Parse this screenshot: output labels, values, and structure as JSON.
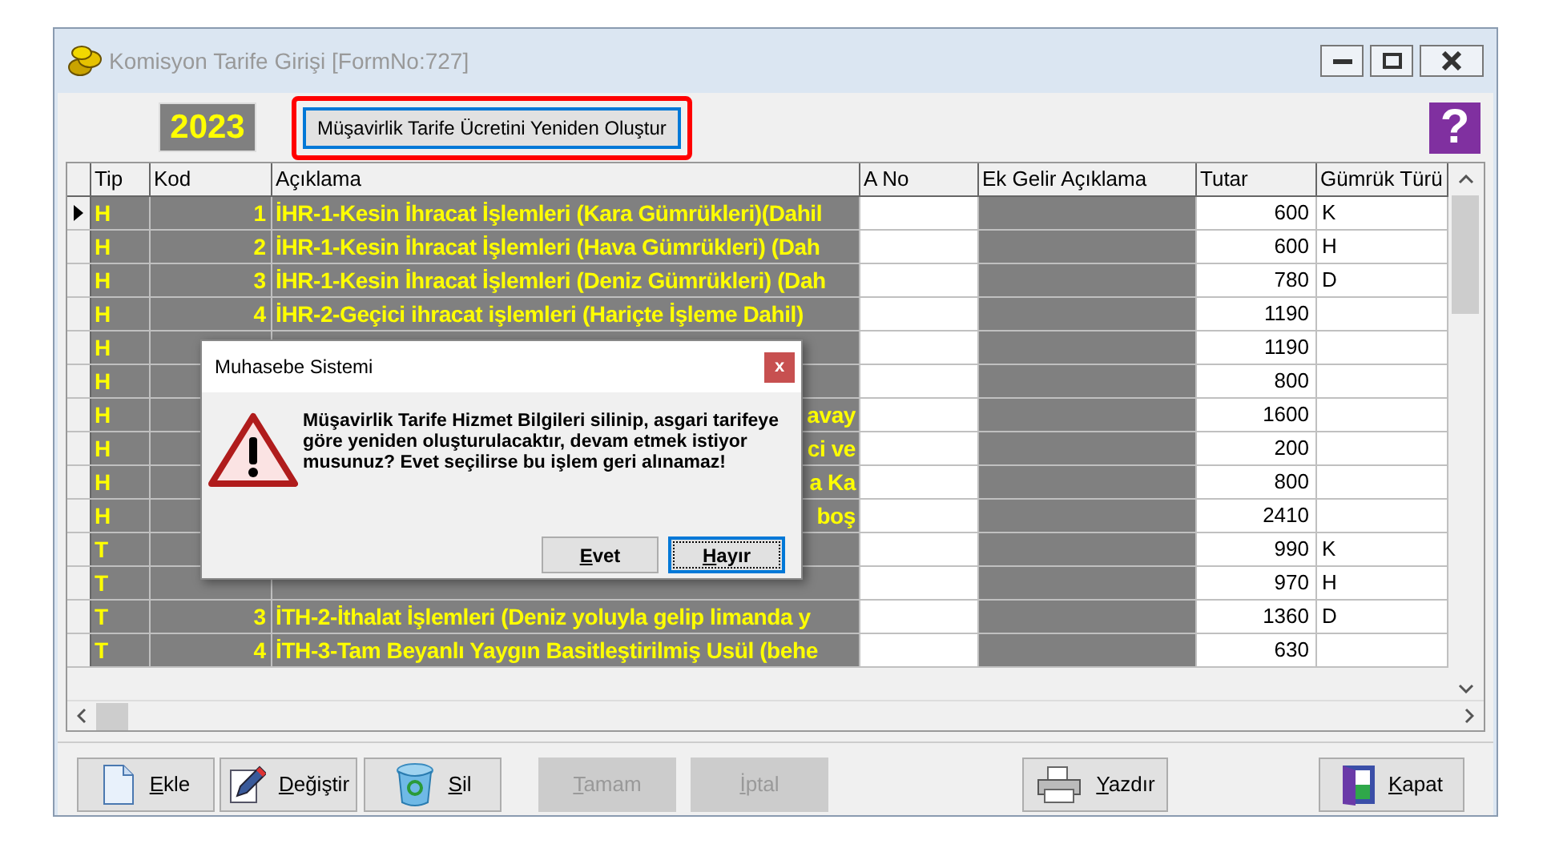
{
  "window": {
    "title": "Komisyon Tarife Girişi [FormNo:727]"
  },
  "toolbar": {
    "year": "2023",
    "rebuild_button": "Müşavirlik Tarife Ücretini Yeniden Oluştur",
    "help_button": "?"
  },
  "table": {
    "columns": [
      "Tip",
      "Kod",
      "Açıklama",
      "A No",
      "Ek Gelir Açıklama",
      "Tutar",
      "Gümrük Türü"
    ],
    "rows": [
      {
        "kind": "full",
        "selected": true,
        "tip": "H",
        "kod": "1",
        "aciklama": "İHR-1-Kesin İhracat İşlemleri (Kara Gümrükleri)(Dahil",
        "tutar": "600",
        "gumruk": "K"
      },
      {
        "kind": "full",
        "selected": false,
        "tip": "H",
        "kod": "2",
        "aciklama": "İHR-1-Kesin İhracat İşlemleri (Hava Gümrükleri) (Dah",
        "tutar": "600",
        "gumruk": "H"
      },
      {
        "kind": "full",
        "selected": false,
        "tip": "H",
        "kod": "3",
        "aciklama": "İHR-1-Kesin İhracat İşlemleri (Deniz Gümrükleri) (Dah",
        "tutar": "780",
        "gumruk": "D"
      },
      {
        "kind": "full",
        "selected": false,
        "tip": "H",
        "kod": "4",
        "aciklama": "İHR-2-Geçici ihracat işlemleri (Hariçte İşleme Dahil)",
        "tutar": "1190"
      },
      {
        "kind": "covered",
        "selected": false,
        "tip": "H",
        "tutar": "1190"
      },
      {
        "kind": "covered",
        "selected": false,
        "tip": "H",
        "tutar": "800"
      },
      {
        "kind": "covered",
        "selected": false,
        "tip": "H",
        "aciklama": "avay",
        "tutar": "1600"
      },
      {
        "kind": "covered",
        "selected": false,
        "tip": "H",
        "aciklama": "ci ve",
        "tutar": "200"
      },
      {
        "kind": "covered",
        "selected": false,
        "tip": "H",
        "aciklama": "a Ka",
        "tutar": "800"
      },
      {
        "kind": "covered",
        "selected": false,
        "tip": "H",
        "aciklama": "boş",
        "tutar": "2410"
      },
      {
        "kind": "covered",
        "selected": false,
        "tip": "T",
        "tutar": "990",
        "gumruk": "K"
      },
      {
        "kind": "covered",
        "selected": false,
        "tip": "T",
        "tutar": "970",
        "gumruk": "H"
      },
      {
        "kind": "full",
        "selected": false,
        "tip": "T",
        "kod": "3",
        "aciklama": "İTH-2-İthalat İşlemleri (Deniz yoluyla gelip limanda y",
        "tutar": "1360",
        "gumruk": "D"
      },
      {
        "kind": "full",
        "selected": false,
        "tip": "T",
        "kod": "4",
        "aciklama": "İTH-3-Tam Beyanlı Yaygın Basitleştirilmiş Usül (behe",
        "tutar": "630"
      }
    ]
  },
  "buttons": [
    {
      "kind": "add",
      "label": "Ekle",
      "disabled": false
    },
    {
      "kind": "edit",
      "label": "Değiştir",
      "disabled": false
    },
    {
      "kind": "delete",
      "label": "Sil",
      "disabled": false
    },
    {
      "kind": "ok",
      "label": "Tamam",
      "disabled": true
    },
    {
      "kind": "cancel",
      "label": "İptal",
      "disabled": true
    },
    {
      "kind": "print",
      "label": "Yazdır",
      "disabled": false
    },
    {
      "kind": "close",
      "label": "Kapat",
      "disabled": false
    }
  ],
  "dialog": {
    "title": "Muhasebe Sistemi",
    "close": "x",
    "message": "Müşavirlik Tarife Hizmet Bilgileri silinip, asgari tarifeye göre yeniden oluşturulacaktır, devam etmek istiyor musunuz? Evet seçilirse bu işlem geri alınamaz!",
    "buttons": [
      {
        "label": "Evet",
        "selected": false
      },
      {
        "label": "Hayır",
        "selected": true
      }
    ]
  }
}
